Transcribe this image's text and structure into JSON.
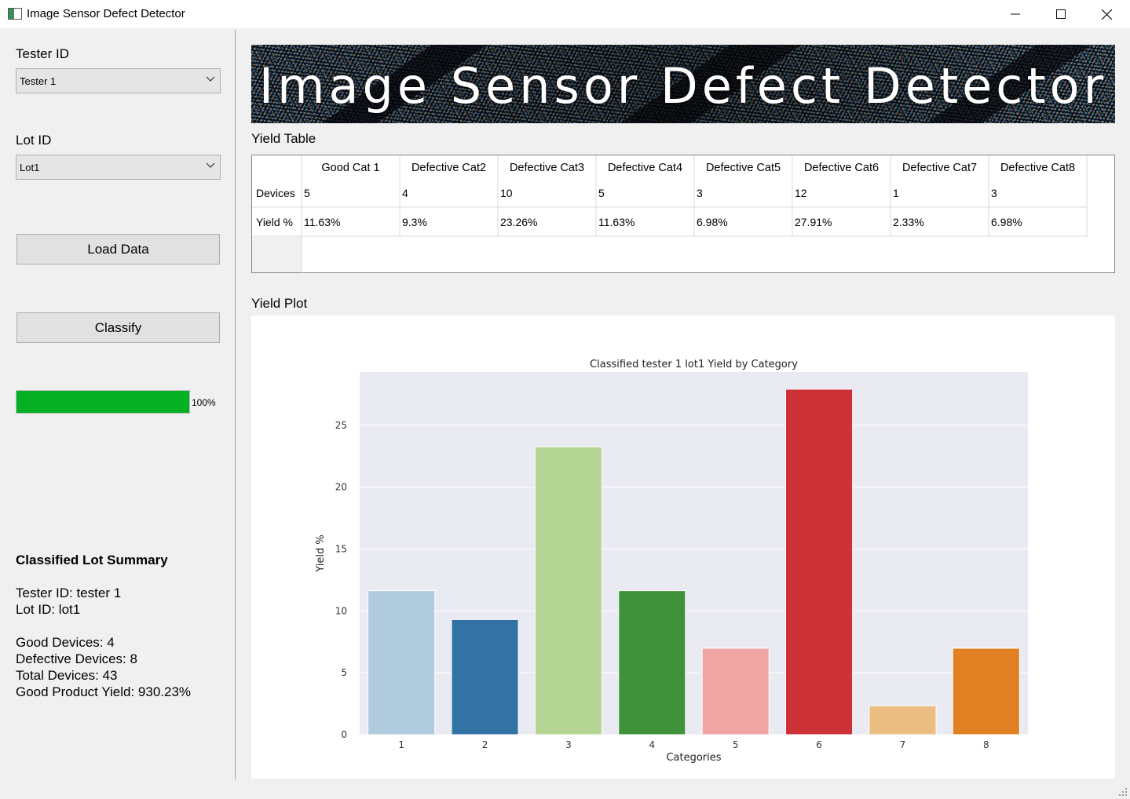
{
  "window": {
    "title": "Image Sensor Defect Detector",
    "minimize": "—",
    "maximize": "☐",
    "close": "✕"
  },
  "sidebar": {
    "tester_label": "Tester ID",
    "tester_value": "Tester 1",
    "lot_label": "Lot ID",
    "lot_value": "Lot1",
    "load_button": "Load Data",
    "classify_button": "Classify",
    "progress": {
      "value": 100,
      "text": "100%"
    },
    "summary": {
      "title": "Classified Lot Summary",
      "tester": "Tester ID: tester 1",
      "lot": "Lot ID: lot1",
      "good": "Good Devices: 4",
      "defective": "Defective Devices: 8",
      "total": "Total Devices: 43",
      "yield": "Good Product Yield: 930.23%"
    }
  },
  "banner": {
    "text": "Image Sensor Defect Detector"
  },
  "yield_table": {
    "label": "Yield Table",
    "columns": [
      "Good Cat 1",
      "Defective Cat2",
      "Defective Cat3",
      "Defective Cat4",
      "Defective Cat5",
      "Defective Cat6",
      "Defective Cat7",
      "Defective Cat8"
    ],
    "rows": [
      {
        "header": "Devices",
        "values": [
          "5",
          "4",
          "10",
          "5",
          "3",
          "12",
          "1",
          "3"
        ]
      },
      {
        "header": "Yield %",
        "values": [
          "11.63%",
          "9.3%",
          "23.26%",
          "11.63%",
          "6.98%",
          "27.91%",
          "2.33%",
          "6.98%"
        ]
      }
    ]
  },
  "yield_plot_label": "Yield Plot",
  "chart_data": {
    "type": "bar",
    "title": "Classified tester 1 lot1 Yield by Category",
    "xlabel": "Categories",
    "ylabel": "Yield %",
    "categories": [
      "1",
      "2",
      "3",
      "4",
      "5",
      "6",
      "7",
      "8"
    ],
    "values": [
      11.63,
      9.3,
      23.26,
      11.63,
      6.98,
      27.91,
      2.33,
      6.98
    ],
    "colors": [
      "#b0cbde",
      "#3373a4",
      "#b4d594",
      "#3f923a",
      "#f0a6a5",
      "#cb3135",
      "#ecbd82",
      "#e08022"
    ],
    "yticks": [
      0,
      5,
      10,
      15,
      20,
      25
    ],
    "ylim": [
      0,
      29.3
    ],
    "background": "#eaeaf2",
    "grid": true
  }
}
